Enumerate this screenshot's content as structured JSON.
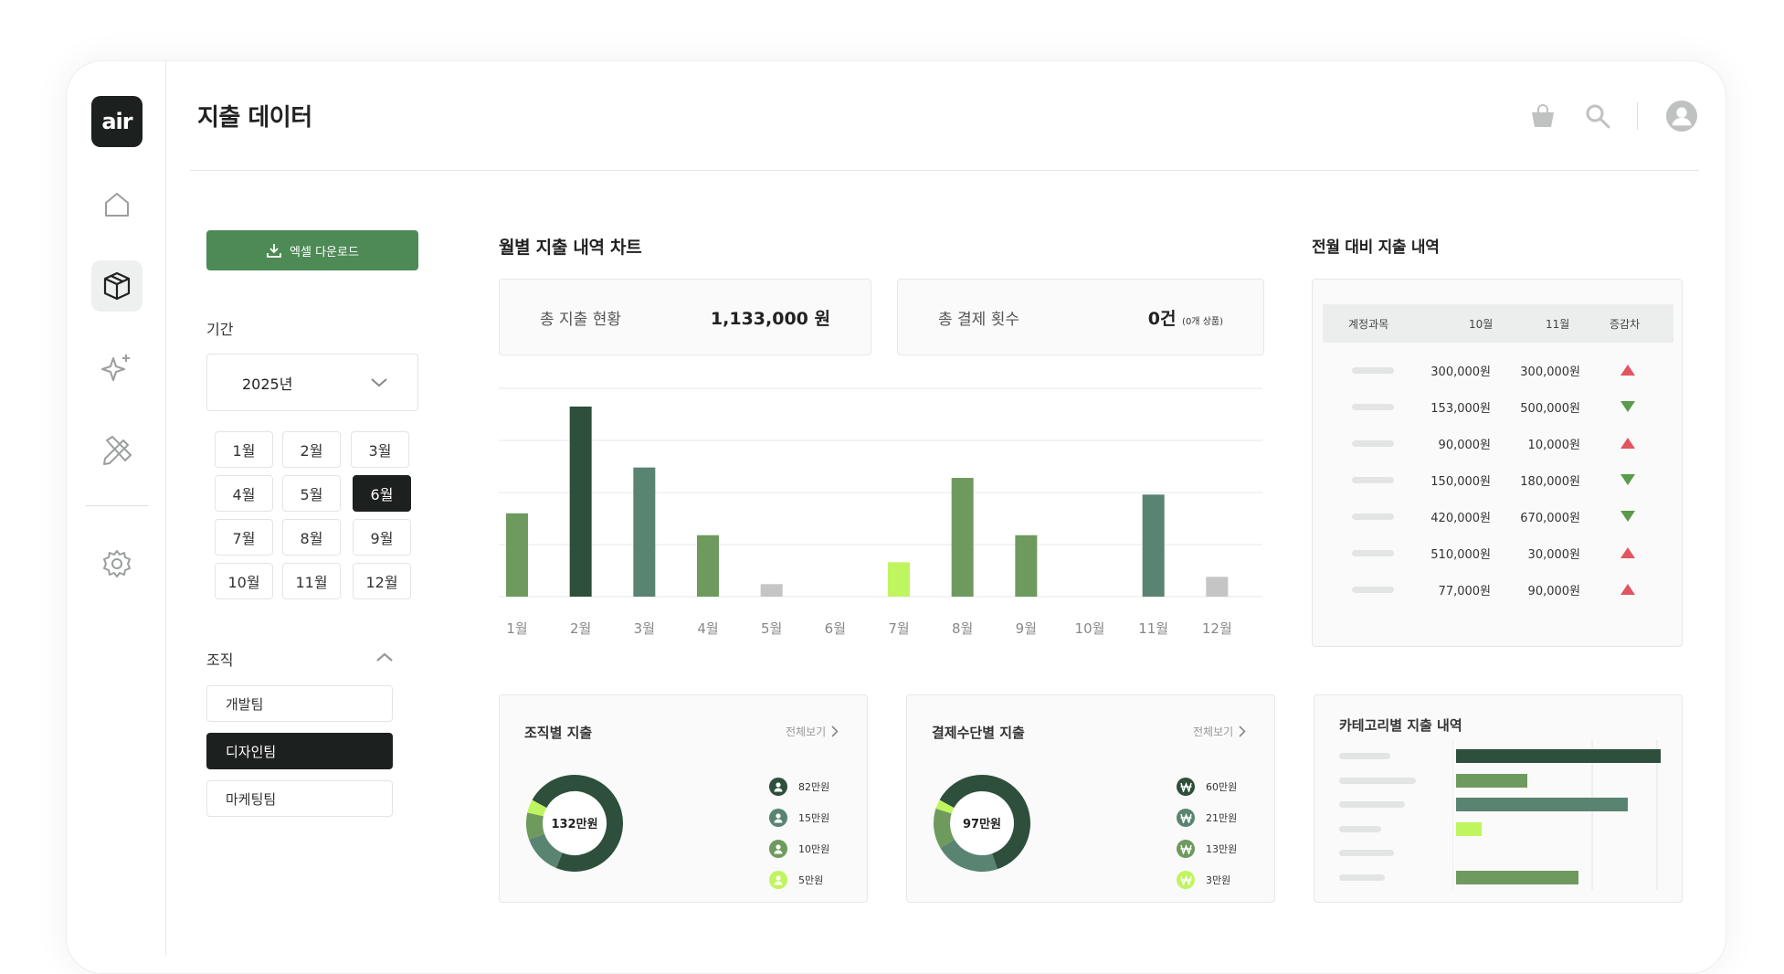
{
  "app": {
    "logo_text": "air"
  },
  "header": {
    "title": "지출 데이터"
  },
  "nav": {
    "items": [
      {
        "name": "home",
        "icon": "home-icon",
        "active": false
      },
      {
        "name": "box",
        "icon": "box-icon",
        "active": true
      },
      {
        "name": "sparkle",
        "icon": "sparkle-icon",
        "active": false
      },
      {
        "name": "design",
        "icon": "pencil-ruler-icon",
        "active": false
      },
      {
        "name": "settings",
        "icon": "gear-icon",
        "active": false
      }
    ]
  },
  "filters": {
    "excel_button": "엑셀 다운로드",
    "period_label": "기간",
    "year": "2025년",
    "months": [
      "1월",
      "2월",
      "3월",
      "4월",
      "5월",
      "6월",
      "7월",
      "8월",
      "9월",
      "10월",
      "11월",
      "12월"
    ],
    "selected_month": "6월",
    "org_label": "조직",
    "orgs": [
      "개발팀",
      "디자인팀",
      "마케팅팀"
    ],
    "selected_org": "디자인팀"
  },
  "monthly": {
    "title": "월별 지출 내역 차트",
    "total_label": "총 지출 현황",
    "total_value": "1,133,000 원",
    "count_label": "총 결제 횟수",
    "count_value": "0건",
    "count_sub": "(0개 상품)"
  },
  "chart_data": {
    "type": "bar",
    "categories": [
      "1월",
      "2월",
      "3월",
      "4월",
      "5월",
      "6월",
      "7월",
      "8월",
      "9월",
      "10월",
      "11월",
      "12월"
    ],
    "values": [
      1.6,
      3.65,
      2.48,
      1.18,
      0.24,
      0,
      0.66,
      2.28,
      1.18,
      0,
      1.96,
      0.38
    ],
    "colors": [
      "#6f9a5e",
      "#2d4f3b",
      "#5a8472",
      "#6f9a5e",
      "#c5c5c5",
      "#6f9a5e",
      "#bff55e",
      "#6f9a5e",
      "#6f9a5e",
      "#6f9a5e",
      "#5a8472",
      "#c5c5c5"
    ],
    "ylim": [
      0,
      4
    ],
    "grid": true
  },
  "comparison": {
    "title": "전월 대비 지출 내역",
    "headers": [
      "계정과목",
      "10월",
      "11월",
      "증감차"
    ],
    "rows": [
      {
        "oct": "300,000원",
        "nov": "300,000원",
        "trend": "up"
      },
      {
        "oct": "153,000원",
        "nov": "500,000원",
        "trend": "down"
      },
      {
        "oct": "90,000원",
        "nov": "10,000원",
        "trend": "up"
      },
      {
        "oct": "150,000원",
        "nov": "180,000원",
        "trend": "down"
      },
      {
        "oct": "420,000원",
        "nov": "670,000원",
        "trend": "down"
      },
      {
        "oct": "510,000원",
        "nov": "30,000원",
        "trend": "up"
      },
      {
        "oct": "77,000원",
        "nov": "90,000원",
        "trend": "up"
      }
    ]
  },
  "org_spend": {
    "title": "조직별 지출",
    "more": "전체보기",
    "center": "132만원",
    "legend": [
      "82만원",
      "15만원",
      "10만원",
      "5만원"
    ],
    "slices": [
      82,
      15,
      10,
      5
    ],
    "colors": [
      "#2d4f3b",
      "#5a8472",
      "#6f9a5e",
      "#bff55e"
    ],
    "legend_icon": "person-icon"
  },
  "pay_spend": {
    "title": "결제수단별 지출",
    "more": "전체보기",
    "center": "97만원",
    "legend": [
      "60만원",
      "21만원",
      "13만원",
      "3만원"
    ],
    "slices": [
      60,
      21,
      13,
      3
    ],
    "colors": [
      "#2d4f3b",
      "#5a8472",
      "#6f9a5e",
      "#bff55e"
    ],
    "legend_icon": "won-icon"
  },
  "category": {
    "title": "카테고리별 지출 내역",
    "bars": [
      0.8,
      0.28,
      0.67,
      0.1,
      0,
      0.48
    ],
    "colors": [
      "#2d4f3b",
      "#6f9a5e",
      "#5a8472",
      "#bff55e",
      "#6f9a5e",
      "#6f9a5e"
    ]
  }
}
